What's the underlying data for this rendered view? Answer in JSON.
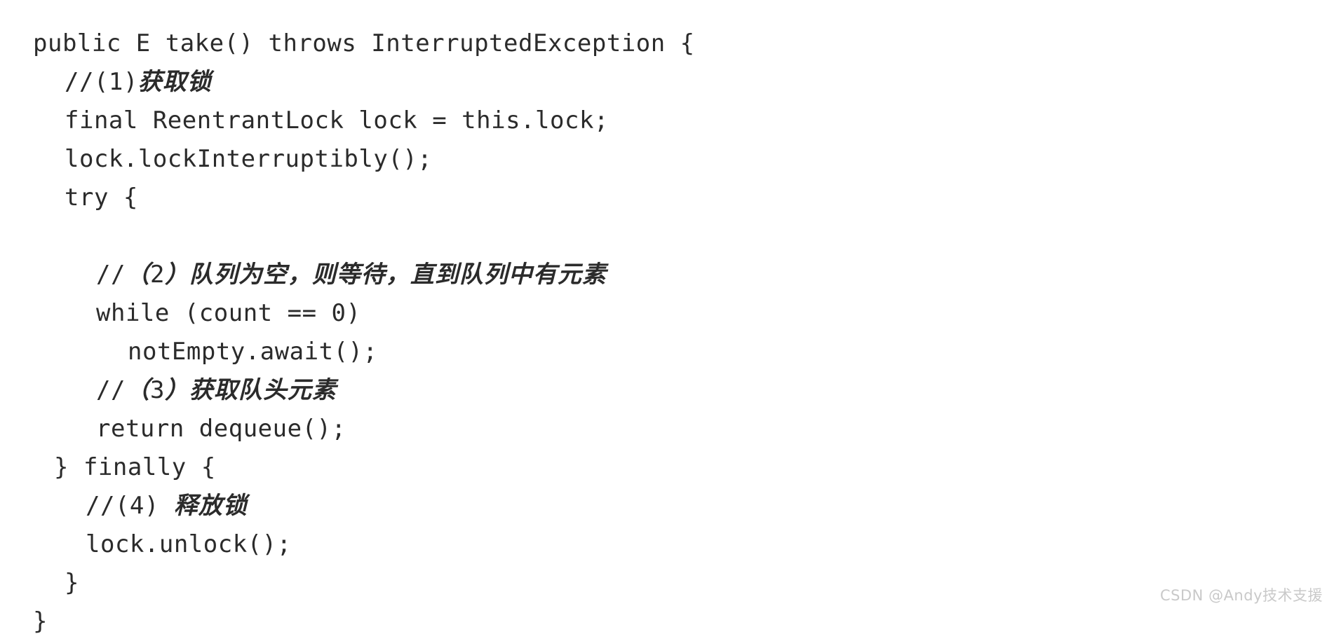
{
  "page": {
    "background_color": "#ffffff",
    "text_color": "#2b2b2b",
    "language": "java"
  },
  "code": {
    "lines": [
      {
        "indent": 0,
        "text": "public E take() throws InterruptedException {",
        "kind": "code"
      },
      {
        "indent": 1,
        "text": "//(1)获取锁",
        "kind": "comment"
      },
      {
        "indent": 1,
        "text": "final ReentrantLock lock = this.lock;",
        "kind": "code"
      },
      {
        "indent": 1,
        "text": "lock.lockInterruptibly();",
        "kind": "code"
      },
      {
        "indent": 1,
        "text": "try {",
        "kind": "code"
      },
      {
        "indent": 0,
        "text": "",
        "kind": "blank"
      },
      {
        "indent": 2,
        "text": "//（2）队列为空，则等待，直到队列中有元素",
        "kind": "comment"
      },
      {
        "indent": 2,
        "text": "while (count == 0)",
        "kind": "code"
      },
      {
        "indent": 3,
        "text": "notEmpty.await();",
        "kind": "code"
      },
      {
        "indent": 2,
        "text": "//（3）获取队头元素",
        "kind": "comment"
      },
      {
        "indent": 2,
        "text": "return dequeue();",
        "kind": "code"
      },
      {
        "indent": 1,
        "text": "} finally {",
        "kind": "code",
        "outdent": true
      },
      {
        "indent": 2,
        "text": "//(4) 释放锁",
        "kind": "comment",
        "outdent": true
      },
      {
        "indent": 2,
        "text": "lock.unlock();",
        "kind": "code",
        "outdent": true
      },
      {
        "indent": 1,
        "text": "}",
        "kind": "code"
      },
      {
        "indent": 0,
        "text": "}",
        "kind": "code"
      }
    ]
  },
  "watermark": {
    "text": "CSDN @Andy技术支援"
  }
}
